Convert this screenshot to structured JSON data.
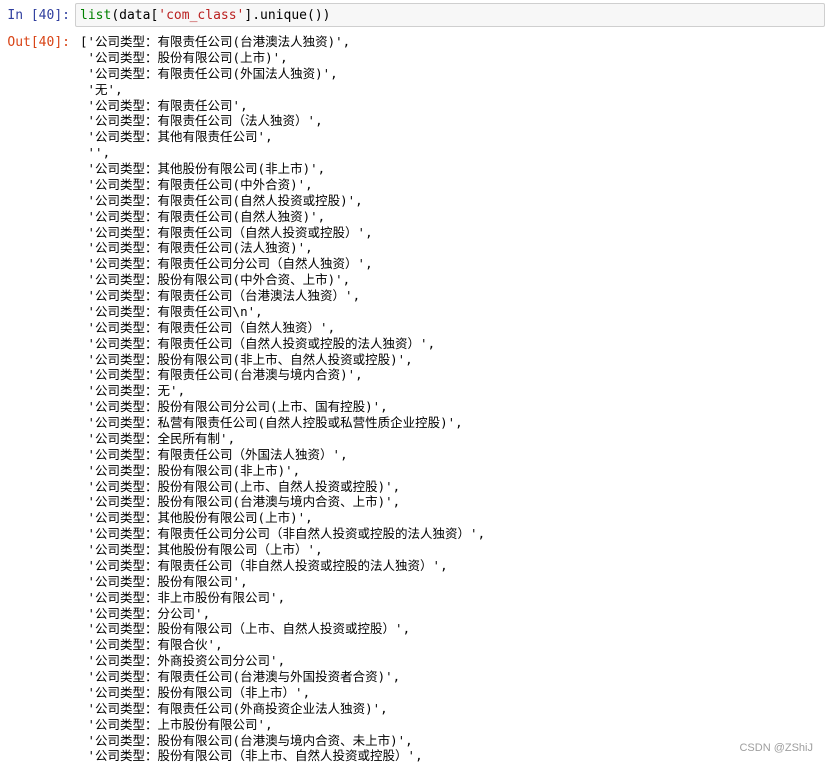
{
  "input_cell": {
    "prompt": "In  [40]:",
    "code_fn": "list",
    "code_mid": "(data[",
    "code_str": "'com_class'",
    "code_end": "].unique())"
  },
  "output_cell": {
    "prompt": "Out[40]:",
    "lines": [
      "['公司类型：有限责任公司(台港澳法人独资)',",
      " '公司类型：股份有限公司(上市)',",
      " '公司类型：有限责任公司(外国法人独资)',",
      " '无',",
      " '公司类型：有限责任公司',",
      " '公司类型：有限责任公司（法人独资）',",
      " '公司类型：其他有限责任公司',",
      " '',",
      " '公司类型：其他股份有限公司(非上市)',",
      " '公司类型：有限责任公司(中外合资)',",
      " '公司类型：有限责任公司(自然人投资或控股)',",
      " '公司类型：有限责任公司(自然人独资)',",
      " '公司类型：有限责任公司（自然人投资或控股）',",
      " '公司类型：有限责任公司(法人独资)',",
      " '公司类型：有限责任公司分公司（自然人独资）',",
      " '公司类型：股份有限公司(中外合资、上市)',",
      " '公司类型：有限责任公司（台港澳法人独资）',",
      " '公司类型：有限责任公司\\n',",
      " '公司类型：有限责任公司（自然人独资）',",
      " '公司类型：有限责任公司（自然人投资或控股的法人独资）',",
      " '公司类型：股份有限公司(非上市、自然人投资或控股)',",
      " '公司类型：有限责任公司(台港澳与境内合资)',",
      " '公司类型：无',",
      " '公司类型：股份有限公司分公司(上市、国有控股)',",
      " '公司类型：私营有限责任公司(自然人控股或私营性质企业控股)',",
      " '公司类型：全民所有制',",
      " '公司类型：有限责任公司（外国法人独资）',",
      " '公司类型：股份有限公司(非上市)',",
      " '公司类型：股份有限公司(上市、自然人投资或控股)',",
      " '公司类型：股份有限公司(台港澳与境内合资、上市)',",
      " '公司类型：其他股份有限公司(上市)',",
      " '公司类型：有限责任公司分公司（非自然人投资或控股的法人独资）',",
      " '公司类型：其他股份有限公司（上市）',",
      " '公司类型：有限责任公司（非自然人投资或控股的法人独资）',",
      " '公司类型：股份有限公司',",
      " '公司类型：非上市股份有限公司',",
      " '公司类型：分公司',",
      " '公司类型：股份有限公司（上市、自然人投资或控股）',",
      " '公司类型：有限合伙',",
      " '公司类型：外商投资公司分公司',",
      " '公司类型：有限责任公司(台港澳与外国投资者合资)',",
      " '公司类型：股份有限公司（非上市）',",
      " '公司类型：有限责任公司(外商投资企业法人独资)',",
      " '公司类型：上市股份有限公司',",
      " '公司类型：股份有限公司(台港澳与境内合资、未上市)',",
      " '公司类型：股份有限公司（非上市、自然人投资或控股）',"
    ]
  },
  "watermark": "CSDN @ZShiJ"
}
